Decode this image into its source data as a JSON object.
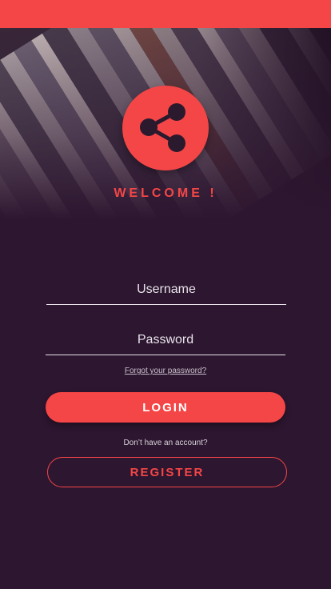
{
  "app": {
    "welcome_text": "WELCOME !"
  },
  "form": {
    "username_placeholder": "Username",
    "password_placeholder": "Password",
    "forgot_link": "Forgot your password?",
    "login_label": "LOGIN",
    "no_account_text": "Don’t have an account?",
    "register_label": "REGISTER"
  },
  "icons": {
    "logo": "share-icon"
  },
  "colors": {
    "accent": "#f44646",
    "background": "#2d1630",
    "text_light": "#e8e2ea"
  }
}
